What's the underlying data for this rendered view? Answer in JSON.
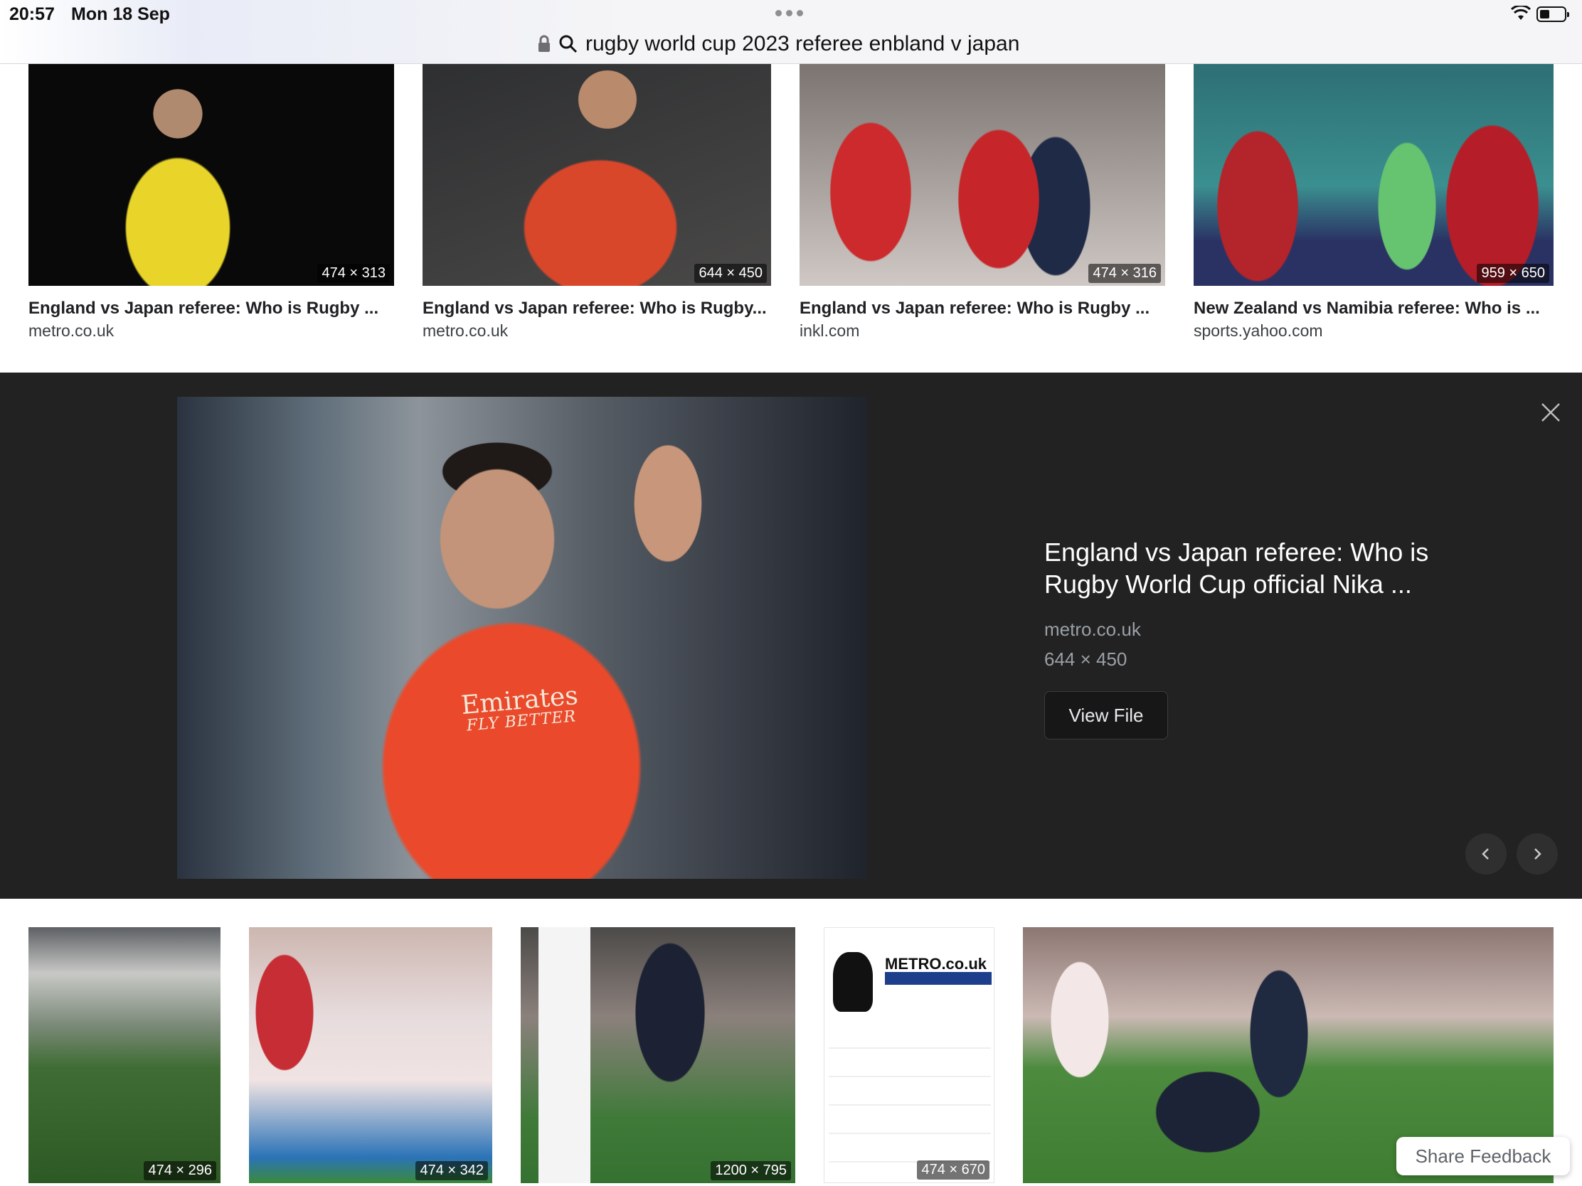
{
  "status": {
    "time": "20:57",
    "date": "Mon 18 Sep"
  },
  "address": {
    "query": "rugby world cup 2023 referee enbland v japan"
  },
  "top_results": [
    {
      "size": "474 × 313",
      "title": "England vs Japan referee: Who is Rugby ...",
      "source": "metro.co.uk"
    },
    {
      "size": "644 × 450",
      "title": "England vs Japan referee: Who is Rugby...",
      "source": "metro.co.uk"
    },
    {
      "size": "474 × 316",
      "title": "England vs Japan referee: Who is Rugby ...",
      "source": "inkl.com"
    },
    {
      "size": "959 × 650",
      "title": "New Zealand vs Namibia referee: Who is ...",
      "source": "sports.yahoo.com"
    }
  ],
  "detail": {
    "title": "England vs Japan referee: Who is Rugby World Cup official Nika ...",
    "source": "metro.co.uk",
    "size": "644 × 450",
    "view_file_label": "View File",
    "shirt_text": "Emirates",
    "shirt_subtext": "FLY BETTER"
  },
  "bottom_results": [
    {
      "size": "474 × 296"
    },
    {
      "size": "474 × 342"
    },
    {
      "size": "1200 × 795"
    },
    {
      "size": "474 × 670"
    },
    {
      "size": ""
    }
  ],
  "metro_doc": {
    "brand": "METRO.co.uk"
  },
  "feedback": {
    "label": "Share Feedback"
  },
  "icons": {
    "lock": "lock-icon",
    "search": "search-icon",
    "wifi": "wifi-icon",
    "battery": "battery-icon",
    "close": "close-icon",
    "prev": "chevron-left-icon",
    "next": "chevron-right-icon"
  }
}
